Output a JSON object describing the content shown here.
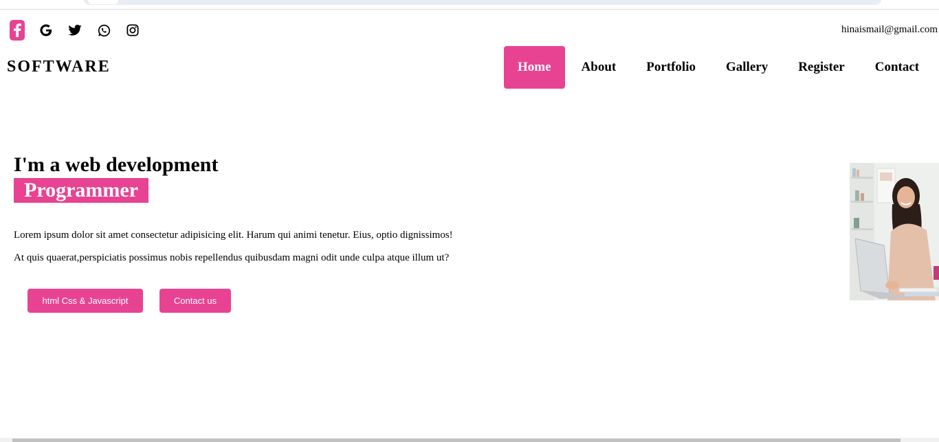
{
  "social": {
    "icons": [
      "facebook-icon",
      "google-icon",
      "twitter-icon",
      "whatsapp-icon",
      "instagram-icon"
    ],
    "email": "hinaismail@gmail.com"
  },
  "header": {
    "brand": "SOFTWARE",
    "nav": [
      "Home",
      "About",
      "Portfolio",
      "Gallery",
      "Register",
      "Contact"
    ],
    "active": "Home"
  },
  "hero": {
    "title": "I'm a web development",
    "highlight": "Programmer",
    "paragraph1": "Lorem ipsum dolor sit amet consectetur adipisicing elit. Harum qui animi tenetur. Eius, optio dignissimos!",
    "paragraph2": "At quis quaerat,perspiciatis possimus nobis repellendus quibusdam magni odit unde culpa atque illum ut?",
    "button1": "html Css & Javascript",
    "button2": "Contact us"
  },
  "colors": {
    "accent": "#e84393",
    "text": "#000000",
    "background": "#ffffff"
  }
}
